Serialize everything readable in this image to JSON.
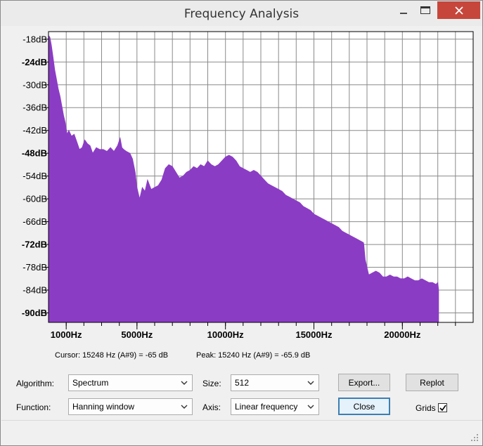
{
  "window": {
    "title": "Frequency Analysis"
  },
  "chart_data": {
    "type": "area",
    "color": "#8b3cc4",
    "grid": true,
    "xlabel": "",
    "ylabel": "",
    "xlim": [
      0,
      24000
    ],
    "ylim": [
      -92.5,
      -16
    ],
    "y_ticks": [
      "-18dB",
      "-24dB",
      "-30dB",
      "-36dB",
      "-42dB",
      "-48dB",
      "-54dB",
      "-60dB",
      "-66dB",
      "-72dB",
      "-78dB",
      "-84dB",
      "-90dB"
    ],
    "y_tick_values": [
      -18,
      -24,
      -30,
      -36,
      -42,
      -48,
      -54,
      -60,
      -66,
      -72,
      -78,
      -84,
      -90
    ],
    "y_ticks_bold": [
      false,
      true,
      false,
      false,
      false,
      true,
      false,
      false,
      false,
      true,
      false,
      false,
      true
    ],
    "x_ticks": [
      "1000Hz",
      "5000Hz",
      "10000Hz",
      "15000Hz",
      "20000Hz"
    ],
    "x_tick_values": [
      1000,
      5000,
      10000,
      15000,
      20000
    ],
    "x_minor_step": 1000,
    "spectrum": {
      "x": [
        0,
        80,
        160,
        250,
        350,
        450,
        550,
        650,
        750,
        850,
        950,
        1050,
        1150,
        1300,
        1450,
        1600,
        1750,
        1900,
        2050,
        2200,
        2350,
        2500,
        2700,
        2900,
        3100,
        3300,
        3500,
        3700,
        3900,
        4050,
        4150,
        4250,
        4400,
        4600,
        4750,
        4900,
        5000,
        5150,
        5300,
        5450,
        5600,
        5800,
        6000,
        6200,
        6400,
        6600,
        6800,
        7000,
        7200,
        7400,
        7600,
        7800,
        8000,
        8200,
        8400,
        8600,
        8800,
        9000,
        9200,
        9400,
        9600,
        9800,
        10000,
        10200,
        10400,
        10600,
        10800,
        11000,
        11200,
        11400,
        11600,
        11800,
        12000,
        12200,
        12400,
        12600,
        12800,
        13000,
        13200,
        13400,
        13600,
        13800,
        14000,
        14200,
        14400,
        14600,
        14800,
        15000,
        15200,
        15400,
        15600,
        15800,
        16000,
        16200,
        16400,
        16600,
        16800,
        17000,
        17200,
        17400,
        17600,
        17800,
        17820,
        17900,
        18100,
        18300,
        18500,
        18700,
        18900,
        19100,
        19300,
        19500,
        19700,
        19900,
        20100,
        20300,
        20500,
        20700,
        20900,
        21100,
        21300,
        21500,
        21700,
        21900,
        22000,
        22050
      ],
      "db": [
        -17,
        -17.5,
        -19.5,
        -22.5,
        -26,
        -28.5,
        -31,
        -33,
        -35.5,
        -38,
        -40,
        -43,
        -42,
        -43.5,
        -43,
        -45,
        -47,
        -46.5,
        -44.5,
        -45.5,
        -46,
        -48,
        -46.5,
        -47,
        -47,
        -47.5,
        -46.5,
        -47.5,
        -46,
        -44,
        -46.5,
        -47,
        -47.5,
        -48,
        -49.5,
        -53,
        -57,
        -60,
        -57,
        -58,
        -55,
        -57.5,
        -57,
        -56.5,
        -55,
        -52,
        -51,
        -51.5,
        -53,
        -54.5,
        -54,
        -53,
        -52.5,
        -51.5,
        -52,
        -51,
        -51.5,
        -50,
        -51,
        -51.5,
        -51,
        -50,
        -49,
        -48.5,
        -49,
        -50,
        -51.5,
        -52,
        -52.5,
        -53,
        -52.5,
        -53,
        -54,
        -55,
        -56,
        -56.5,
        -57,
        -57.5,
        -58,
        -59,
        -59.5,
        -60,
        -60.5,
        -61,
        -62,
        -62.5,
        -63,
        -64,
        -64.5,
        -65,
        -65.5,
        -66,
        -66.5,
        -67,
        -67.5,
        -68.5,
        -69,
        -69.5,
        -70,
        -70.5,
        -71,
        -71.5,
        -72,
        -76,
        -80,
        -79.5,
        -79,
        -79.5,
        -80.5,
        -80.5,
        -80,
        -80.5,
        -80.5,
        -81,
        -81,
        -80.5,
        -81,
        -81.5,
        -81.5,
        -81,
        -81.5,
        -82,
        -82,
        -82.5,
        -82,
        -84,
        -89.5,
        -92.5
      ]
    }
  },
  "status": {
    "cursor": "Cursor: 15248 Hz (A#9) = -65 dB",
    "peak": "Peak: 15240 Hz (A#9) = -65.9 dB"
  },
  "controls": {
    "algorithm_label": "Algorithm:",
    "algorithm_value": "Spectrum",
    "function_label": "Function:",
    "function_value": "Hanning window",
    "size_label": "Size:",
    "size_value": "512",
    "axis_label": "Axis:",
    "axis_value": "Linear frequency",
    "export_label": "Export...",
    "replot_label": "Replot",
    "close_label": "Close",
    "grids_label": "Grids",
    "grids_checked": true
  }
}
